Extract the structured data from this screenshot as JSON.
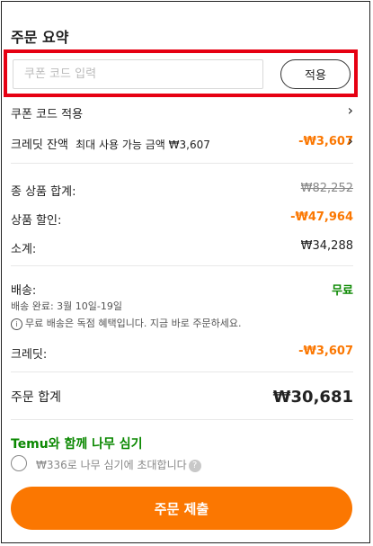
{
  "summary": {
    "title": "주문 요약"
  },
  "coupon": {
    "placeholder": "쿠폰 코드 입력",
    "apply_label": "적용",
    "link_label": "쿠폰 코드 적용"
  },
  "credit_line": {
    "label": "크레딧 잔액",
    "detail": "최대 사용 가능 금액 ₩3,607",
    "value": "-₩3,607"
  },
  "totals": {
    "items_total_label": "종 상품 합계:",
    "items_total_value": "₩82,252",
    "discount_label": "상품 할인:",
    "discount_value": "-₩47,964",
    "subtotal_label": "소계:",
    "subtotal_value": "₩34,288"
  },
  "shipping": {
    "label": "배송:",
    "value": "무료",
    "eta": "배송 완료: 3월 10일-19일",
    "note": "무료 배송은 독점 혜택입니다. 지금 바로 주문하세요."
  },
  "credit": {
    "label": "크레딧:",
    "value": "-₩3,607"
  },
  "order_total": {
    "label": "주문 합계",
    "value": "₩30,681"
  },
  "tree": {
    "title": "Temu와 함께 나무 심기",
    "option": "₩336로 나무 심기에 초대합니다"
  },
  "submit_label": "주문 제출",
  "colors": {
    "accent": "#fb7701",
    "highlight": "#e60012",
    "green": "#0a8800"
  },
  "icons": {
    "chevron": "chevron-right-icon",
    "info": "info-icon",
    "help": "question-icon"
  }
}
